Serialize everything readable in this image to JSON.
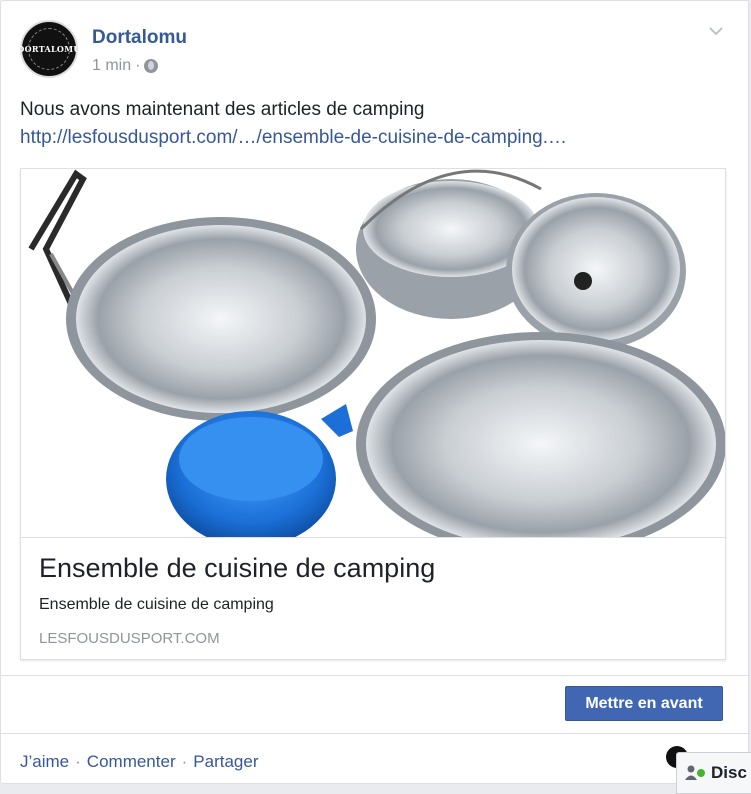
{
  "post": {
    "author": "Dortalomu",
    "avatar_text": "DORTALOMU",
    "time": "1 min",
    "meta_sep": "·",
    "message": "Nous avons maintenant des articles de camping",
    "link": "http://lesfousdusport.com/…/ensemble-de-cuisine-de-camping.…"
  },
  "card": {
    "title": "Ensemble de cuisine de camping",
    "description": "Ensemble de cuisine de camping",
    "domain": "LESFOUSDUSPORT.COM"
  },
  "boost_label": "Mettre en avant",
  "actions": {
    "like": "J’aime",
    "comment": "Commenter",
    "share": "Partager",
    "sep": "·"
  },
  "chat_label": "Disc",
  "icons": {
    "privacy": "globe-icon",
    "menu": "chevron-down-icon",
    "chat": "chat-contacts-icon"
  },
  "colors": {
    "link": "#365899",
    "button": "#4267b2",
    "online": "#42b72a"
  }
}
